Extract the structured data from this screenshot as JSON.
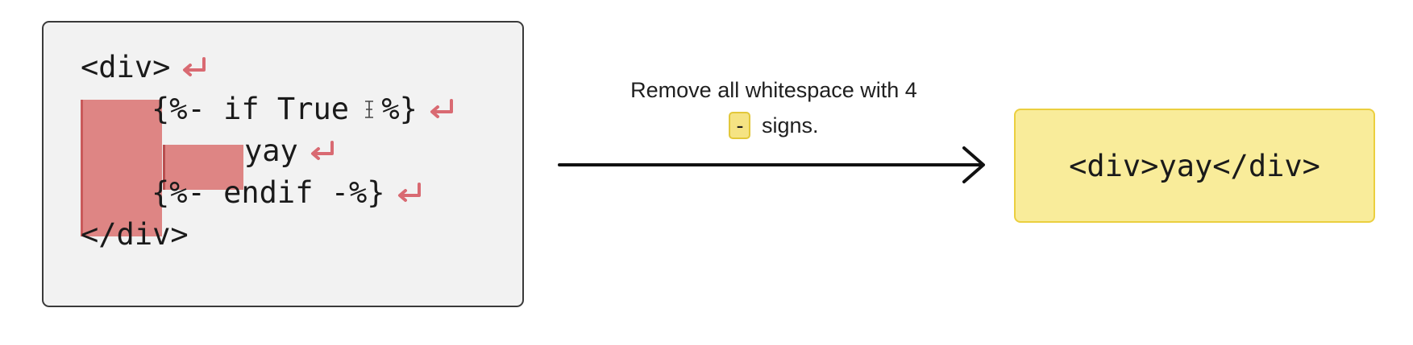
{
  "code_panel": {
    "lines": {
      "l1": "<div>",
      "l2_start": "{%- if True ",
      "l2_end": "%}",
      "l3": "yay",
      "l4": "{%- endif -%}",
      "l5": "</div>"
    },
    "colors": {
      "whitespace_highlight": "#de8584",
      "return_glyph": "#d96a72"
    }
  },
  "caption": {
    "line1": "Remove all whitespace with 4",
    "dash": "-",
    "line2_rest": "signs."
  },
  "result": {
    "code": "<div>yay</div>",
    "background": "#f9ec9a"
  },
  "icons": {
    "return": "return-arrow-icon",
    "cursor": "text-cursor-icon",
    "arrow": "right-arrow-icon"
  }
}
